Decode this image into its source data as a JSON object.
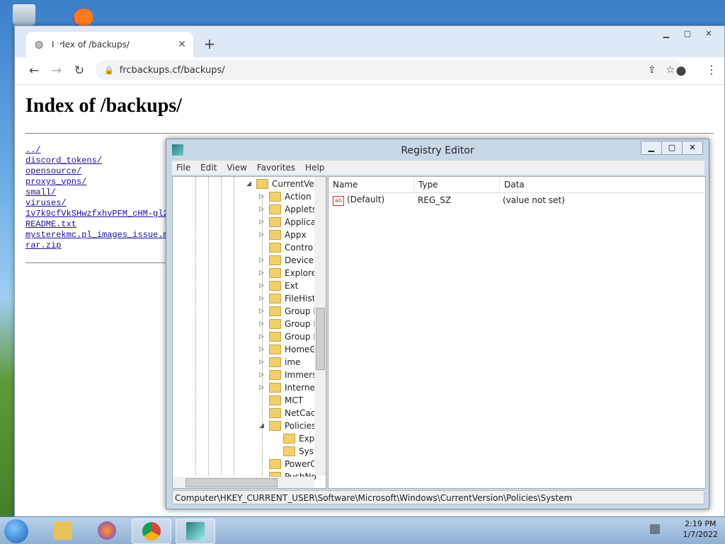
{
  "browser": {
    "tab_title": "Index of /backups/",
    "url": "frcbackups.cf/backups/",
    "new_tab": "+",
    "tab_close": "✕",
    "nav": {
      "back": "←",
      "forward": "→",
      "reload": "↻"
    }
  },
  "page": {
    "heading": "Index of /backups/",
    "links": [
      "../",
      "discord_tokens/",
      "opensource/",
      "proxys_vpns/",
      "small/",
      "viruses/",
      "1v7k9cfVkSHwzfxhvPFM_cHM-gl2",
      "README.txt",
      "mysterekmc.pl_images_issue.m",
      "rar.zip"
    ]
  },
  "regedit": {
    "title": "Registry Editor",
    "menu": [
      "File",
      "Edit",
      "View",
      "Favorites",
      "Help"
    ],
    "tree_root": "CurrentVer",
    "tree_items": [
      "Action",
      "Applets",
      "Applica",
      "Appx",
      "Contro",
      "Device",
      "Explore",
      "Ext",
      "FileHist",
      "Group I",
      "Group I",
      "Group I",
      "HomeG",
      "ime",
      "Immers",
      "Interne",
      "MCT",
      "NetCac",
      "Policies"
    ],
    "tree_sub": [
      "Exp",
      "Syst"
    ],
    "tree_after": [
      "PowerC",
      "PushNo"
    ],
    "columns": [
      "Name",
      "Type",
      "Data"
    ],
    "rows": [
      {
        "name": "(Default)",
        "type": "REG_SZ",
        "data": "(value not set)"
      }
    ],
    "status": "Computer\\HKEY_CURRENT_USER\\Software\\Microsoft\\Windows\\CurrentVersion\\Policies\\System"
  },
  "taskbar": {
    "time": "2:19 PM",
    "date": "1/7/2022"
  }
}
